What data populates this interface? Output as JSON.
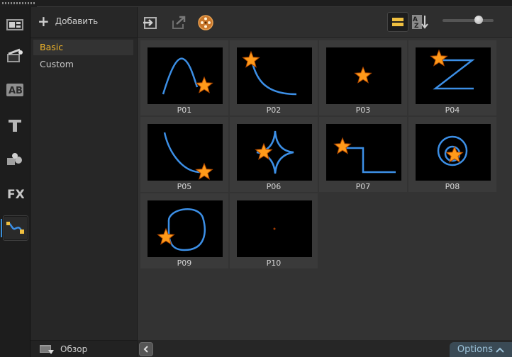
{
  "library": {
    "add_label": "Добавить",
    "categories": [
      {
        "label": "Basic",
        "selected": true
      },
      {
        "label": "Custom",
        "selected": false
      }
    ],
    "browse_label": "Обзор"
  },
  "rail": {
    "items": [
      "media-icon",
      "instant-project-icon",
      "title-icon",
      "text-icon",
      "graphics-icon",
      "fx-icon",
      "path-icon"
    ],
    "active": "path-icon",
    "fx_text": "FX"
  },
  "toolbar": {
    "items": [
      "import-icon",
      "export-icon",
      "reel-icon"
    ],
    "zoom_fraction": 0.75
  },
  "paths": [
    {
      "name": "P01"
    },
    {
      "name": "P02"
    },
    {
      "name": "P03"
    },
    {
      "name": "P04"
    },
    {
      "name": "P05"
    },
    {
      "name": "P06"
    },
    {
      "name": "P07"
    },
    {
      "name": "P08"
    },
    {
      "name": "P09"
    },
    {
      "name": "P10"
    }
  ],
  "footer": {
    "options_label": "Options"
  },
  "colors": {
    "accent": "#f0b429",
    "path_line": "#3c8fe6",
    "star": "#ff9a1a"
  }
}
